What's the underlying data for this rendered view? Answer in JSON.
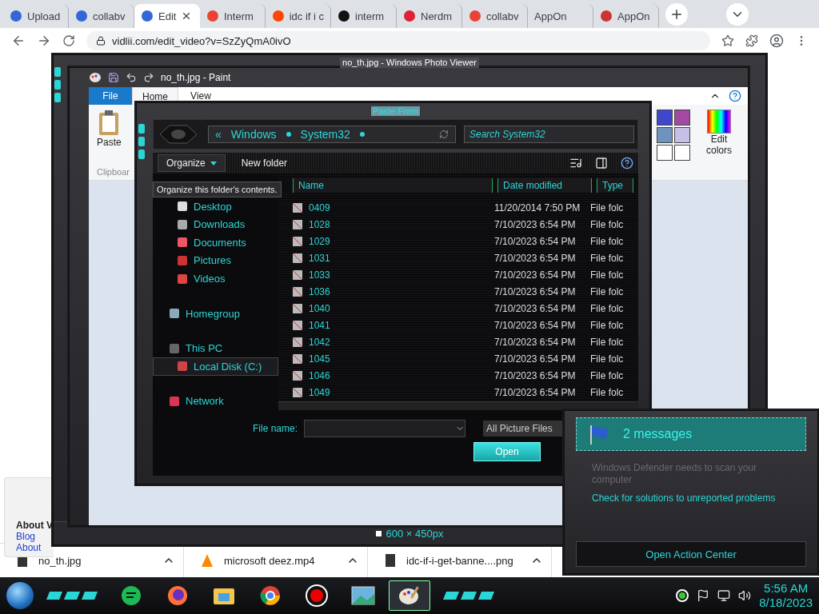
{
  "browser": {
    "tabs": [
      {
        "title": "Upload",
        "kind": "v",
        "selected": false
      },
      {
        "title": "collabv",
        "kind": "v",
        "selected": false
      },
      {
        "title": "Edit",
        "kind": "v",
        "selected": true
      },
      {
        "title": "Interm",
        "kind": "g",
        "selected": false
      },
      {
        "title": "idc if i c",
        "kind": "alien",
        "selected": false
      },
      {
        "title": "interm",
        "kind": "note",
        "selected": false
      },
      {
        "title": "Nerdm",
        "kind": "bird",
        "selected": false
      },
      {
        "title": "collabv",
        "kind": "g",
        "selected": false
      },
      {
        "title": "AppOn",
        "kind": "none",
        "selected": false
      },
      {
        "title": "AppOn",
        "kind": "flag",
        "selected": false
      }
    ],
    "address": "vidlii.com/edit_video?v=SzZyQmA0ivO",
    "page_box": {
      "heading": "About V",
      "links": [
        "Blog",
        "About"
      ]
    }
  },
  "downloads": [
    {
      "name": "no_th.jpg",
      "kind": "file"
    },
    {
      "name": "microsoft deez.mp4",
      "kind": "cone"
    },
    {
      "name": "idc-if-i-get-banne....png",
      "kind": "file"
    }
  ],
  "photo_viewer": {
    "title": "no_th.jpg - Windows Photo Viewer",
    "dimensions": "600 × 450px"
  },
  "paint": {
    "title": "no_th.jpg - Paint",
    "tabs": [
      {
        "label": "File",
        "kind": "file",
        "selected": false
      },
      {
        "label": "Home",
        "kind": "tab",
        "selected": true
      },
      {
        "label": "View",
        "kind": "tab",
        "selected": false
      }
    ],
    "paste": "Paste",
    "group": "Clipboar",
    "edit_colors": "Edit colors",
    "palette": [
      {
        "color": "#3f48cc"
      },
      {
        "color": "#a349a4"
      },
      {
        "color": "#7092be"
      },
      {
        "color": "#c8bfe7"
      },
      {
        "color": "#ffffff"
      },
      {
        "color": "#ffffff"
      }
    ]
  },
  "dialog": {
    "title": "Paste From",
    "back": "«",
    "path": [
      "Windows",
      "System32"
    ],
    "search": {
      "placeholder": "Search System32"
    },
    "organize": "Organize",
    "new_folder": "New folder",
    "tooltip": "Organize this folder's contents.",
    "nav": [
      {
        "children": [
          {
            "label": "Desktop",
            "kind": "desktop",
            "selected": false
          },
          {
            "label": "Downloads",
            "kind": "downloads",
            "selected": false
          },
          {
            "label": "Documents",
            "kind": "documents",
            "selected": false
          },
          {
            "label": "Pictures",
            "kind": "pictures",
            "selected": false
          },
          {
            "label": "Videos",
            "kind": "videos",
            "selected": false
          }
        ]
      },
      {
        "label": "Homegroup",
        "kind": "homegroup",
        "selected": false
      },
      {
        "label": "This PC",
        "kind": "pc",
        "selected": false,
        "children": [
          {
            "label": "Local Disk (C:)",
            "kind": "disk",
            "selected": true
          }
        ]
      },
      {
        "label": "Network",
        "kind": "network",
        "selected": false
      }
    ],
    "columns": [
      "Name",
      "Date modified",
      "Type"
    ],
    "rows": [
      {
        "name": "0409",
        "date": "11/20/2014 7:50 PM",
        "type": "File folc"
      },
      {
        "name": "1028",
        "date": "7/10/2023 6:54 PM",
        "type": "File folc"
      },
      {
        "name": "1029",
        "date": "7/10/2023 6:54 PM",
        "type": "File folc"
      },
      {
        "name": "1031",
        "date": "7/10/2023 6:54 PM",
        "type": "File folc"
      },
      {
        "name": "1033",
        "date": "7/10/2023 6:54 PM",
        "type": "File folc"
      },
      {
        "name": "1036",
        "date": "7/10/2023 6:54 PM",
        "type": "File folc"
      },
      {
        "name": "1040",
        "date": "7/10/2023 6:54 PM",
        "type": "File folc"
      },
      {
        "name": "1041",
        "date": "7/10/2023 6:54 PM",
        "type": "File folc"
      },
      {
        "name": "1042",
        "date": "7/10/2023 6:54 PM",
        "type": "File folc"
      },
      {
        "name": "1045",
        "date": "7/10/2023 6:54 PM",
        "type": "File folc"
      },
      {
        "name": "1046",
        "date": "7/10/2023 6:54 PM",
        "type": "File folc"
      },
      {
        "name": "1049",
        "date": "7/10/2023 6:54 PM",
        "type": "File folc"
      }
    ],
    "file_name_label": "File name:",
    "file_type": "All Picture Files",
    "open": "Open"
  },
  "notification": {
    "title": "2 messages",
    "messages": [
      {
        "text": "Windows Defender needs to scan your computer",
        "kind": "muted"
      },
      {
        "text": "Check for solutions to unreported problems",
        "kind": "link"
      }
    ],
    "action": "Open Action Center"
  },
  "taskbar": {
    "apps": [
      {
        "kind": "chat",
        "selected": false
      },
      {
        "kind": "fox",
        "selected": false
      },
      {
        "kind": "folder",
        "selected": false
      },
      {
        "kind": "chrome",
        "selected": false
      },
      {
        "kind": "record",
        "selected": false
      },
      {
        "kind": "photo",
        "selected": false
      },
      {
        "kind": "paint",
        "selected": true
      }
    ],
    "time": "5:56 AM",
    "date": "8/18/2023"
  }
}
